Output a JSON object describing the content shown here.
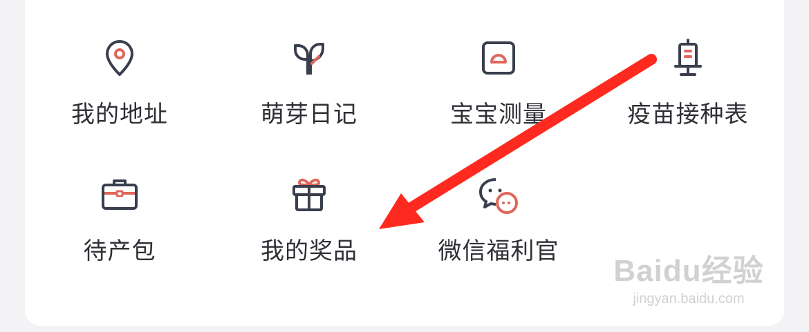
{
  "colors": {
    "icon_dark": "#3a3f4d",
    "icon_accent": "#e0665a",
    "arrow": "#ff2a1f"
  },
  "grid": {
    "row1": [
      {
        "label": "我的地址",
        "icon": "location-pin-icon"
      },
      {
        "label": "萌芽日记",
        "icon": "sprout-leaf-icon"
      },
      {
        "label": "宝宝测量",
        "icon": "measure-scale-icon"
      },
      {
        "label": "疫苗接种表",
        "icon": "vaccine-syringe-icon"
      }
    ],
    "row2": [
      {
        "label": "待产包",
        "icon": "briefcase-icon"
      },
      {
        "label": "我的奖品",
        "icon": "gift-icon"
      },
      {
        "label": "微信福利官",
        "icon": "wechat-chat-icon"
      }
    ]
  },
  "watermark": {
    "brand": "Baidu经验",
    "url": "jingyan.baidu.com"
  },
  "annotation": {
    "arrow_target": "gift-item"
  }
}
